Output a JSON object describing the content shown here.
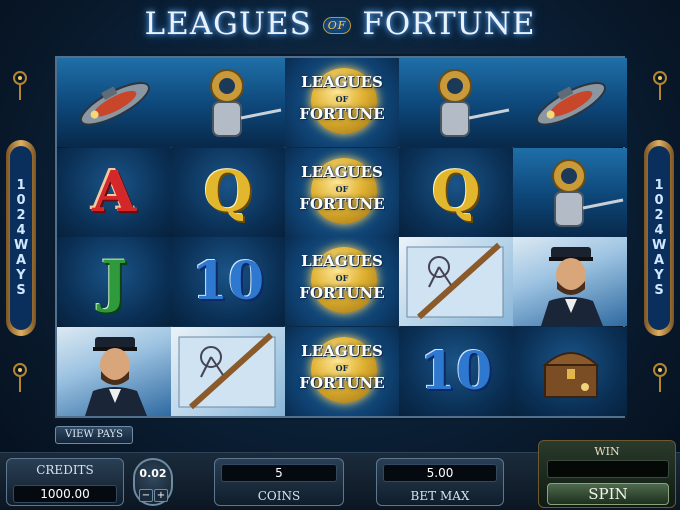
{
  "game": {
    "title_left": "LEAGUES",
    "title_of": "OF",
    "title_right": "FORTUNE"
  },
  "side_badge": {
    "left": "1024 WAYS",
    "right": "1024 WAYS"
  },
  "reels": [
    [
      {
        "symbol": "submarine",
        "scene": "sea"
      },
      {
        "symbol": "A",
        "scene": "deep"
      },
      {
        "symbol": "J",
        "scene": "deep"
      },
      {
        "symbol": "captain",
        "scene": "sky"
      }
    ],
    [
      {
        "symbol": "diver",
        "scene": "sea"
      },
      {
        "symbol": "Q",
        "scene": "deep"
      },
      {
        "symbol": "10",
        "scene": "deep"
      },
      {
        "symbol": "map",
        "scene": "map"
      }
    ],
    [
      {
        "symbol": "wild",
        "scene": "gold"
      },
      {
        "symbol": "wild",
        "scene": "gold"
      },
      {
        "symbol": "wild",
        "scene": "gold"
      },
      {
        "symbol": "wild",
        "scene": "gold"
      }
    ],
    [
      {
        "symbol": "diver",
        "scene": "sea"
      },
      {
        "symbol": "Q",
        "scene": "deep"
      },
      {
        "symbol": "map",
        "scene": "map"
      },
      {
        "symbol": "10",
        "scene": "deep"
      }
    ],
    [
      {
        "symbol": "submarine",
        "scene": "sea"
      },
      {
        "symbol": "diver",
        "scene": "sea"
      },
      {
        "symbol": "captain",
        "scene": "sky"
      },
      {
        "symbol": "treasure-chest",
        "scene": "deep"
      }
    ]
  ],
  "wild": {
    "line1": "LEAGUES",
    "line2": "OF",
    "line3": "FORTUNE"
  },
  "letters": {
    "A": "A",
    "Q": "Q",
    "J": "J",
    "T": "10"
  },
  "controls": {
    "view_pays": "VIEW PAYS",
    "credits_label": "CREDITS",
    "credits_value": "1000.00",
    "coin_value": "0.02",
    "coin_minus": "−",
    "coin_plus": "+",
    "coins_value": "5",
    "coins_label": "COINS",
    "bet_value": "5.00",
    "bet_label": "BET MAX",
    "win_label": "WIN",
    "win_value": "",
    "spin_label": "SPIN"
  },
  "colors": {
    "background": "#0a1e33",
    "gold": "#e0b232",
    "ace_red": "#d4272a",
    "jack_green": "#2e9a3c",
    "ten_blue": "#2f78d0"
  }
}
